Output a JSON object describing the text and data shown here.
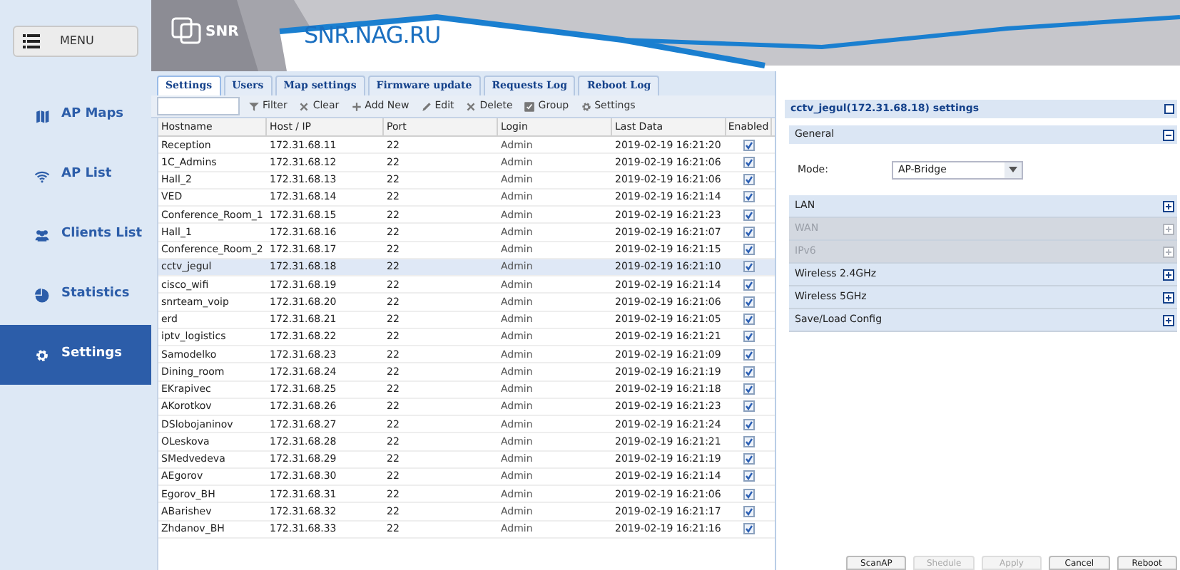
{
  "menu_button": {
    "label": "MENU"
  },
  "sidebar": {
    "items": [
      {
        "label": "AP Maps",
        "selected": false
      },
      {
        "label": "AP List",
        "selected": false
      },
      {
        "label": "Clients List",
        "selected": false
      },
      {
        "label": "Statistics",
        "selected": false
      },
      {
        "label": "Settings",
        "selected": true
      }
    ]
  },
  "header": {
    "logo": "SNR",
    "site": "SNR.NAG.RU"
  },
  "tabs": [
    {
      "label": "Settings",
      "selected": true
    },
    {
      "label": "Users",
      "selected": false
    },
    {
      "label": "Map settings",
      "selected": false
    },
    {
      "label": "Firmware update",
      "selected": false
    },
    {
      "label": "Requests Log",
      "selected": false
    },
    {
      "label": "Reboot Log",
      "selected": false
    }
  ],
  "toolbar": [
    {
      "label": "Filter"
    },
    {
      "label": "Clear"
    },
    {
      "label": "Add New"
    },
    {
      "label": "Edit"
    },
    {
      "label": "Delete"
    },
    {
      "label": "Group"
    },
    {
      "label": "Settings"
    }
  ],
  "table": {
    "columns": [
      "Hostname",
      "Host / IP",
      "Port",
      "Login",
      "Last Data",
      "Enabled"
    ],
    "rows": [
      {
        "hostname": "Reception",
        "ip": "172.31.68.11",
        "port": "22",
        "login": "Admin",
        "last": "2019-02-19 16:21:20",
        "enabled": true,
        "selected": false
      },
      {
        "hostname": "1C_Admins",
        "ip": "172.31.68.12",
        "port": "22",
        "login": "Admin",
        "last": "2019-02-19 16:21:06",
        "enabled": true,
        "selected": false
      },
      {
        "hostname": "Hall_2",
        "ip": "172.31.68.13",
        "port": "22",
        "login": "Admin",
        "last": "2019-02-19 16:21:06",
        "enabled": true,
        "selected": false
      },
      {
        "hostname": "VED",
        "ip": "172.31.68.14",
        "port": "22",
        "login": "Admin",
        "last": "2019-02-19 16:21:14",
        "enabled": true,
        "selected": false
      },
      {
        "hostname": "Conference_Room_1",
        "ip": "172.31.68.15",
        "port": "22",
        "login": "Admin",
        "last": "2019-02-19 16:21:23",
        "enabled": true,
        "selected": false
      },
      {
        "hostname": "Hall_1",
        "ip": "172.31.68.16",
        "port": "22",
        "login": "Admin",
        "last": "2019-02-19 16:21:07",
        "enabled": true,
        "selected": false
      },
      {
        "hostname": "Conference_Room_2",
        "ip": "172.31.68.17",
        "port": "22",
        "login": "Admin",
        "last": "2019-02-19 16:21:15",
        "enabled": true,
        "selected": false
      },
      {
        "hostname": "cctv_jegul",
        "ip": "172.31.68.18",
        "port": "22",
        "login": "Admin",
        "last": "2019-02-19 16:21:10",
        "enabled": true,
        "selected": true
      },
      {
        "hostname": "cisco_wifi",
        "ip": "172.31.68.19",
        "port": "22",
        "login": "Admin",
        "last": "2019-02-19 16:21:14",
        "enabled": true,
        "selected": false
      },
      {
        "hostname": "snrteam_voip",
        "ip": "172.31.68.20",
        "port": "22",
        "login": "Admin",
        "last": "2019-02-19 16:21:06",
        "enabled": true,
        "selected": false
      },
      {
        "hostname": "erd",
        "ip": "172.31.68.21",
        "port": "22",
        "login": "Admin",
        "last": "2019-02-19 16:21:05",
        "enabled": true,
        "selected": false
      },
      {
        "hostname": "iptv_logistics",
        "ip": "172.31.68.22",
        "port": "22",
        "login": "Admin",
        "last": "2019-02-19 16:21:21",
        "enabled": true,
        "selected": false
      },
      {
        "hostname": "Samodelko",
        "ip": "172.31.68.23",
        "port": "22",
        "login": "Admin",
        "last": "2019-02-19 16:21:09",
        "enabled": true,
        "selected": false
      },
      {
        "hostname": "Dining_room",
        "ip": "172.31.68.24",
        "port": "22",
        "login": "Admin",
        "last": "2019-02-19 16:21:19",
        "enabled": true,
        "selected": false
      },
      {
        "hostname": "EKrapivec",
        "ip": "172.31.68.25",
        "port": "22",
        "login": "Admin",
        "last": "2019-02-19 16:21:18",
        "enabled": true,
        "selected": false
      },
      {
        "hostname": "AKorotkov",
        "ip": "172.31.68.26",
        "port": "22",
        "login": "Admin",
        "last": "2019-02-19 16:21:23",
        "enabled": true,
        "selected": false
      },
      {
        "hostname": "DSlobojaninov",
        "ip": "172.31.68.27",
        "port": "22",
        "login": "Admin",
        "last": "2019-02-19 16:21:24",
        "enabled": true,
        "selected": false
      },
      {
        "hostname": "OLeskova",
        "ip": "172.31.68.28",
        "port": "22",
        "login": "Admin",
        "last": "2019-02-19 16:21:21",
        "enabled": true,
        "selected": false
      },
      {
        "hostname": "SMedvedeva",
        "ip": "172.31.68.29",
        "port": "22",
        "login": "Admin",
        "last": "2019-02-19 16:21:19",
        "enabled": true,
        "selected": false
      },
      {
        "hostname": "AEgorov",
        "ip": "172.31.68.30",
        "port": "22",
        "login": "Admin",
        "last": "2019-02-19 16:21:14",
        "enabled": true,
        "selected": false
      },
      {
        "hostname": "Egorov_BH",
        "ip": "172.31.68.31",
        "port": "22",
        "login": "Admin",
        "last": "2019-02-19 16:21:06",
        "enabled": true,
        "selected": false
      },
      {
        "hostname": "ABarishev",
        "ip": "172.31.68.32",
        "port": "22",
        "login": "Admin",
        "last": "2019-02-19 16:21:17",
        "enabled": true,
        "selected": false
      },
      {
        "hostname": "Zhdanov_BH",
        "ip": "172.31.68.33",
        "port": "22",
        "login": "Admin",
        "last": "2019-02-19 16:21:16",
        "enabled": true,
        "selected": false
      }
    ]
  },
  "panel": {
    "title": "cctv_jegul(172.31.68.18) settings",
    "general": {
      "label": "General",
      "expanded": true,
      "mode_label": "Mode:",
      "mode_value": "AP-Bridge"
    },
    "sections": [
      {
        "label": "LAN",
        "disabled": false
      },
      {
        "label": "WAN",
        "disabled": true
      },
      {
        "label": "IPv6",
        "disabled": true
      },
      {
        "label": "Wireless 2.4GHz",
        "disabled": false
      },
      {
        "label": "Wireless 5GHz",
        "disabled": false
      },
      {
        "label": "Save/Load Config",
        "disabled": false
      }
    ],
    "buttons": [
      {
        "label": "ScanAP",
        "disabled": false
      },
      {
        "label": "Shedule",
        "disabled": true
      },
      {
        "label": "Apply",
        "disabled": true
      },
      {
        "label": "Cancel",
        "disabled": false
      },
      {
        "label": "Reboot",
        "disabled": false
      }
    ]
  }
}
